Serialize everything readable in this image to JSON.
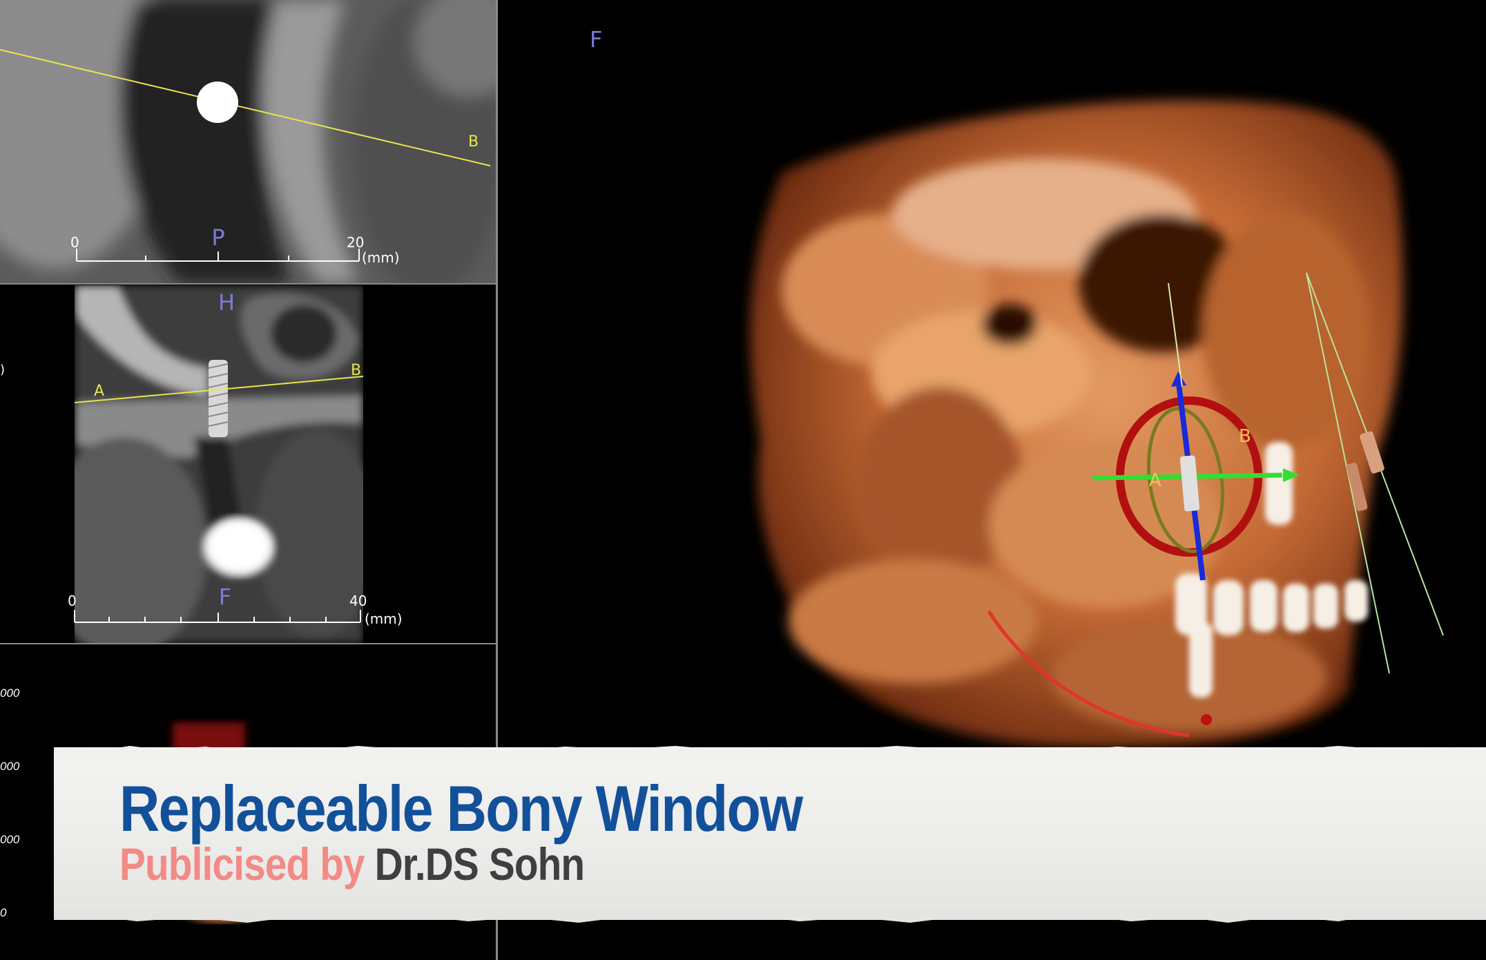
{
  "views": {
    "top": {
      "label_b": "B",
      "orientation_label": "P",
      "scale_start": "0",
      "scale_end": "20",
      "scale_unit": "(mm)"
    },
    "mid": {
      "label_a": "A",
      "label_b": "B",
      "orientation_top": "H",
      "orientation_bottom": "F",
      "scale_start": "0",
      "scale_end": "40",
      "scale_unit": "(mm)"
    },
    "bottom": {
      "tick_labels": [
        "000",
        "000",
        "000",
        "0"
      ]
    },
    "volume3d": {
      "orientation_label": "F",
      "label_a": "A",
      "label_b": "B"
    }
  },
  "banner": {
    "title": "Replaceable Bony Window",
    "subtitle_prefix": "Publicised by",
    "subtitle_author": "Dr.DS Sohn"
  },
  "colors": {
    "title_blue": "#12509a",
    "subtitle_pink": "#f28a86",
    "subtitle_gray": "#3f3f3f",
    "reference_line_yellow": "#e6e650",
    "orientation_purple": "#7b7bd9"
  }
}
